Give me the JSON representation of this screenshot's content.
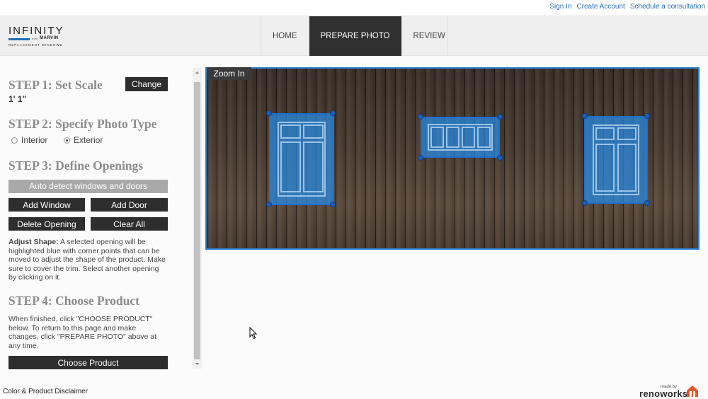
{
  "top_links": [
    "Sign In",
    "Create Account",
    "Schedule a consultation"
  ],
  "logo": {
    "word": "INFINITY",
    "from": "from",
    "brand": "MARVIN",
    "sub": "REPLACEMENT WINDOWS"
  },
  "nav": {
    "tabs": [
      "HOME",
      "PREPARE PHOTO",
      "REVIEW"
    ],
    "active": "PREPARE PHOTO"
  },
  "step1": {
    "title": "STEP 1: Set Scale",
    "button": "Change",
    "value": "1' 1\""
  },
  "step2": {
    "title": "STEP 2: Specify Photo Type",
    "options": [
      "Interior",
      "Exterior"
    ],
    "selected": "Exterior"
  },
  "step3": {
    "title": "STEP 3: Define Openings",
    "auto_detect": "Auto detect windows and doors",
    "add_window": "Add Window",
    "add_door": "Add Door",
    "delete_opening": "Delete Opening",
    "clear_all": "Clear All",
    "adjust_label": "Adjust Shape:",
    "adjust_text": "A selected opening will be highlighted blue with corner points that can be moved to adjust the shape of the product. Make sure to cover the trim. Select another opening by clicking on it."
  },
  "step4": {
    "title": "STEP 4: Choose Product",
    "text": "When finished, click \"CHOOSE PRODUCT\" below. To return to this page and make changes, click \"PREPARE PHOTO\" above at any time.",
    "button": "Choose Product"
  },
  "photo": {
    "zoom": "Zoom In",
    "openings_count": 3,
    "highlight_color": "#2a7fd4"
  },
  "footer": {
    "disclaimer": "Color & Product Disclaimer",
    "made_by": "made by",
    "brand": "renoworks"
  },
  "colors": {
    "accent": "#2a7fd4",
    "dark_button": "#2e2e2e",
    "link": "#2b6fb3"
  }
}
